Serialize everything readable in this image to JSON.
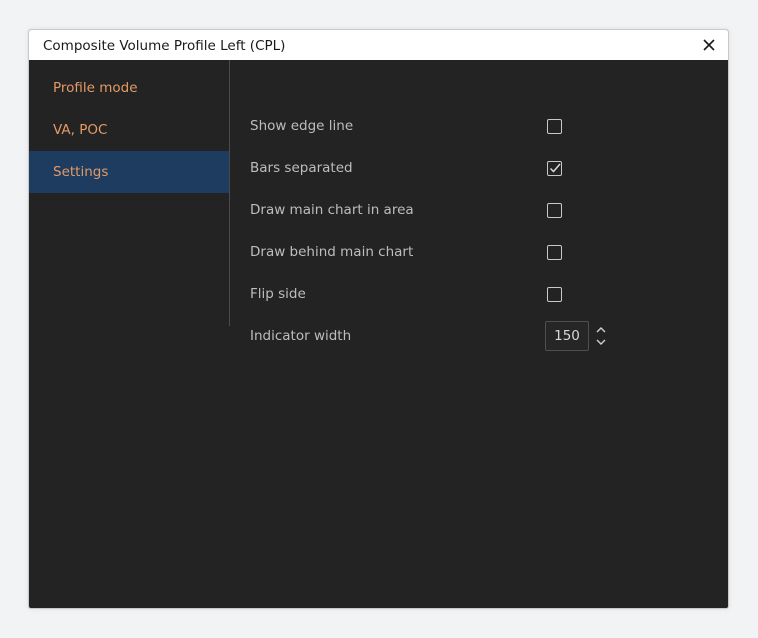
{
  "window": {
    "title": "Composite Volume Profile Left (CPL)"
  },
  "sidebar": {
    "items": [
      {
        "label": "Profile mode",
        "active": false
      },
      {
        "label": "VA, POC",
        "active": false
      },
      {
        "label": "Settings",
        "active": true
      }
    ]
  },
  "settings": {
    "show_edge_line": {
      "label": "Show edge line",
      "checked": false
    },
    "bars_separated": {
      "label": "Bars separated",
      "checked": true
    },
    "draw_main_chart_in_area": {
      "label": "Draw main chart in area",
      "checked": false
    },
    "draw_behind_main_chart": {
      "label": "Draw behind main chart",
      "checked": false
    },
    "flip_side": {
      "label": "Flip side",
      "checked": false
    },
    "indicator_width": {
      "label": "Indicator width",
      "value": "150"
    }
  },
  "colors": {
    "accent_text": "#e39a66",
    "active_nav_bg": "#1d3c5f",
    "panel_bg": "#232323"
  },
  "icons": {
    "close": "close-icon",
    "check": "checkmark-icon",
    "increment": "chevron-up-icon",
    "decrement": "chevron-down-icon"
  }
}
